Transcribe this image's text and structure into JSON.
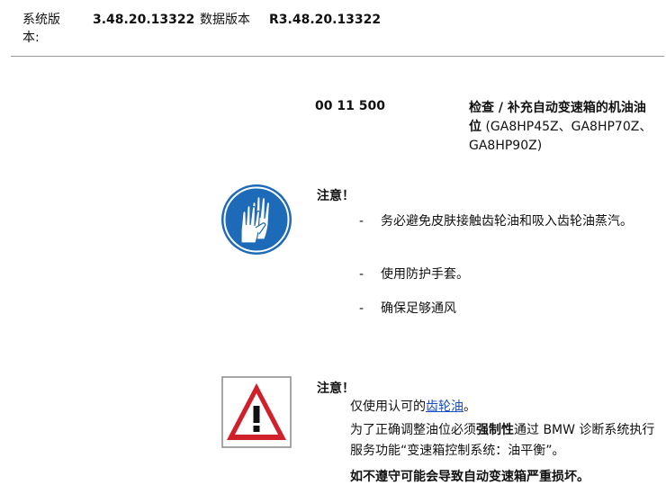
{
  "header": {
    "system_version_label": "系统版本:",
    "system_version_value": "3.48.20.13322",
    "data_version_label": "数据版本",
    "data_version_value": "R3.48.20.13322"
  },
  "document": {
    "number": "00 11 500",
    "title_bold": "检查 / 补充自动变速箱的机油油位",
    "title_models": " (GA8HP45Z、GA8HP70Z、GA8HP90Z)"
  },
  "notice1": {
    "heading": "注意！",
    "icon": "gloves-icon",
    "items": [
      "务必避免皮肤接触齿轮油和吸入齿轮油蒸汽。",
      "使用防护手套。",
      "确保足够通风"
    ]
  },
  "notice2": {
    "heading": "注意！",
    "icon": "warning-triangle-icon",
    "line1_prefix": "仅使用认可的",
    "line1_link": "齿轮油",
    "line1_suffix": "。",
    "p2_a": "为了正确调整油位必须",
    "p2_bold": "强制性",
    "p2_b": "通过 BMW 诊断系统执行服务功能“变速箱控制系统：油平衡”。",
    "p3": "如不遵守可能会导致自动变速箱严重损坏。"
  },
  "colors": {
    "blue_icon": "#1d6bb8",
    "warning_red": "#d0202a",
    "link": "#1a4cc2"
  }
}
